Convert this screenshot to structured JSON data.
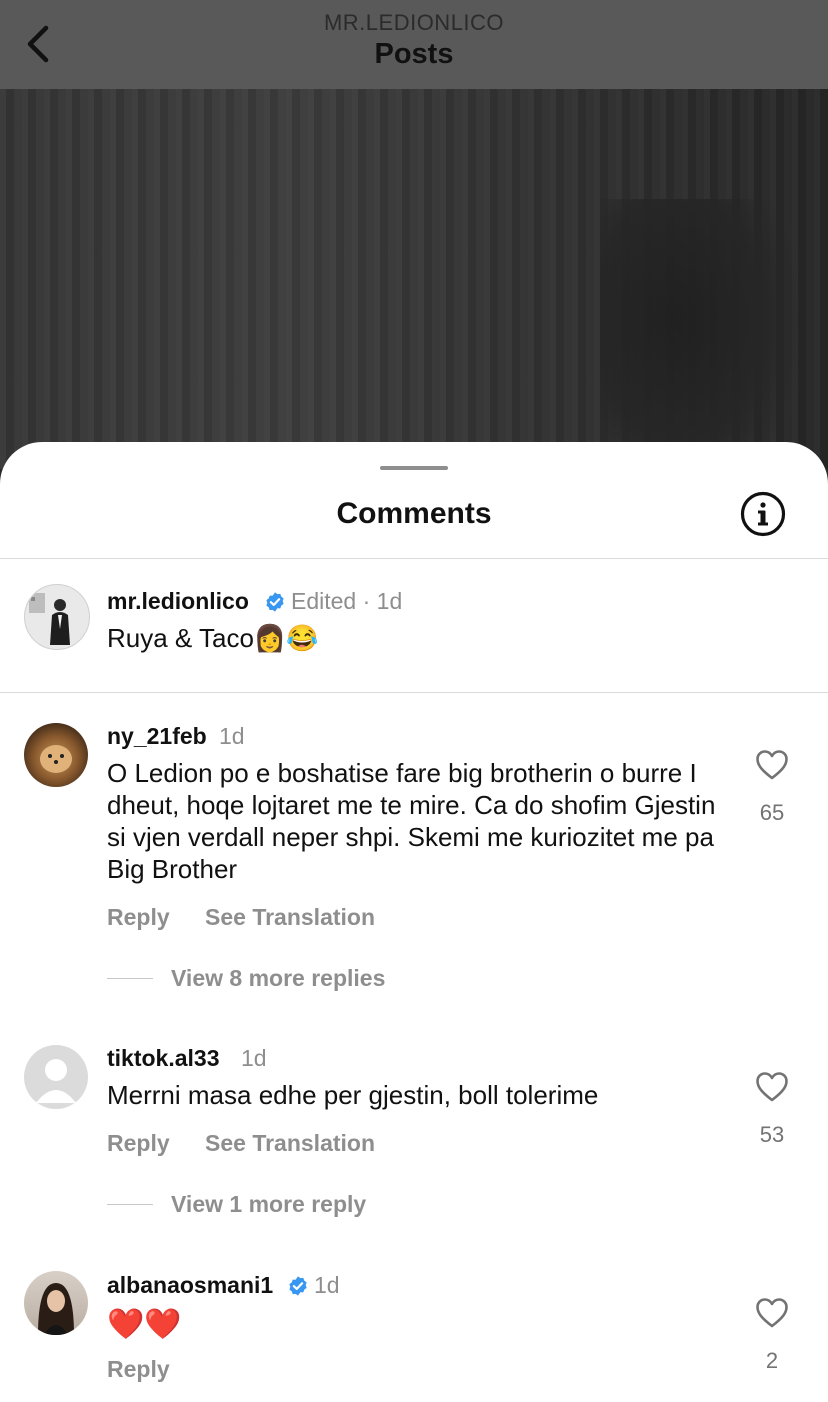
{
  "header": {
    "account": "MR.LEDIONLICO",
    "title": "Posts"
  },
  "sheet": {
    "title": "Comments"
  },
  "caption": {
    "username": "mr.ledionlico",
    "meta": "Edited · 1d",
    "text": "Ruya & Taco👩😂"
  },
  "comments": [
    {
      "username": "ny_21feb",
      "time": "1d",
      "text": "O Ledion po e boshatise fare big brotherin o burre I dheut, hoqe lojtaret me te mire. Ca do shofim Gjestin si vjen verdall neper shpi. Skemi me kuriozitet me pa Big Brother",
      "reply_label": "Reply",
      "translate_label": "See Translation",
      "view_replies": "View 8 more replies",
      "likes": "65"
    },
    {
      "username": "tiktok.al33",
      "time": "1d",
      "text": "Merrni masa edhe per gjestin, boll tolerime",
      "reply_label": "Reply",
      "translate_label": "See Translation",
      "view_replies": "View 1 more reply",
      "likes": "53"
    },
    {
      "username": "albanaosmani1",
      "time": "1d",
      "text": "❤️❤️",
      "reply_label": "Reply",
      "likes": "2"
    }
  ],
  "colors": {
    "verified": "#3897f0",
    "muted": "#8e8e8e",
    "text": "#111111"
  }
}
